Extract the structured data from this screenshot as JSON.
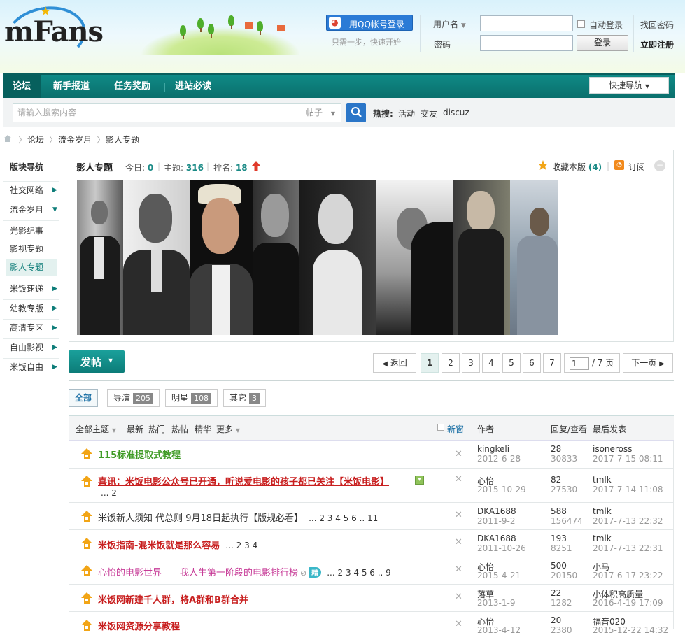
{
  "header": {
    "logo_text": "mFans",
    "qq_login": "用QQ帐号登录",
    "qq_sub": "只需一步，快速开始",
    "username_label": "用户名",
    "password_label": "密码",
    "auto_login": "自动登录",
    "forgot": "找回密码",
    "login_button": "登录",
    "register": "立即注册"
  },
  "nav": {
    "items": [
      "论坛",
      "新手报道",
      "任务奖励",
      "进站必读"
    ],
    "quick_nav": "快捷导航"
  },
  "search": {
    "placeholder": "请输入搜索内容",
    "type": "帖子",
    "hot_label": "热搜:",
    "hot": [
      "活动",
      "交友",
      "discuz"
    ]
  },
  "breadcrumb": [
    "论坛",
    "流金岁月",
    "影人专题"
  ],
  "sidebar": {
    "title": "版块导航",
    "groups": [
      "社交网络",
      "流金岁月"
    ],
    "sub": [
      "光影纪事",
      "影视专题",
      "影人专题"
    ],
    "more": [
      "米饭速递",
      "幼教专版",
      "高清专区",
      "自由影视",
      "米饭自由"
    ]
  },
  "forum": {
    "name": "影人专题",
    "today_label": "今日:",
    "today": "0",
    "topics_label": "主题:",
    "topics": "316",
    "rank_label": "排名:",
    "rank": "18",
    "fav_label": "收藏本版",
    "fav_count": "(4)",
    "subscribe": "订阅"
  },
  "toolbar": {
    "post_button": "发帖",
    "back": "返回",
    "pages": [
      "1",
      "2",
      "3",
      "4",
      "5",
      "6",
      "7"
    ],
    "page_input": "1",
    "page_total": "/ 7 页",
    "next": "下一页"
  },
  "filters": [
    {
      "label": "全部",
      "count": ""
    },
    {
      "label": "导演",
      "count": "205"
    },
    {
      "label": "明星",
      "count": "108"
    },
    {
      "label": "其它",
      "count": "3"
    }
  ],
  "table_header": {
    "all_topics": "全部主题",
    "tabs": [
      "最新",
      "热门",
      "热帖",
      "精华",
      "更多"
    ],
    "new_window": "新窗",
    "author": "作者",
    "reply_view": "回复/查看",
    "last_post": "最后发表"
  },
  "threads": [
    {
      "title": "115标准提取式教程",
      "pages": "",
      "author": "kingkeli",
      "date": "2012-6-28",
      "replies": "28",
      "views": "30833",
      "last_user": "isoneross",
      "last_time": "2017-7-15 08:11"
    },
    {
      "title": "喜讯：米饭电影公众号已开通，听说爱电影的孩子都已关注【米饭电影】",
      "pages": "... 2",
      "author": "心怡",
      "date": "2015-10-29",
      "replies": "82",
      "views": "27530",
      "last_user": "tmlk",
      "last_time": "2017-7-14 11:08"
    },
    {
      "title": "米饭新人须知 代总则 9月18日起执行【版规必看】",
      "pages": "... 2 3 4 5 6 .. 11",
      "author": "DKA1688",
      "date": "2011-9-2",
      "replies": "588",
      "views": "156474",
      "last_user": "tmlk",
      "last_time": "2017-7-13 22:32"
    },
    {
      "title": "米饭指南-混米饭就是那么容易",
      "pages": "... 2 3 4",
      "author": "DKA1688",
      "date": "2011-10-26",
      "replies": "193",
      "views": "8251",
      "last_user": "tmlk",
      "last_time": "2017-7-13 22:31"
    },
    {
      "title": "心怡的电影世界——我人生第一阶段的电影排行榜",
      "pages": "... 2 3 4 5 6 .. 9",
      "badge": "精",
      "author": "心怡",
      "date": "2015-4-21",
      "replies": "500",
      "views": "20150",
      "last_user": "小马",
      "last_time": "2017-6-17 23:22"
    },
    {
      "title": "米饭网新建千人群，将A群和B群合并",
      "pages": "",
      "author": "落草",
      "date": "2013-1-9",
      "replies": "22",
      "views": "1282",
      "last_user": "小体积高质量",
      "last_time": "2016-4-19 17:09"
    },
    {
      "title": "米饭网资源分享教程",
      "pages": "",
      "author": "心怡",
      "date": "2013-4-12",
      "replies": "20",
      "views": "2380",
      "last_user": "福音020",
      "last_time": "2015-12-22 14:32"
    }
  ],
  "colors": {
    "nav": "#0f8a86",
    "accent_red": "#c81f1f",
    "accent_green": "#3e9a24",
    "link_blue": "#1a6fa5"
  }
}
